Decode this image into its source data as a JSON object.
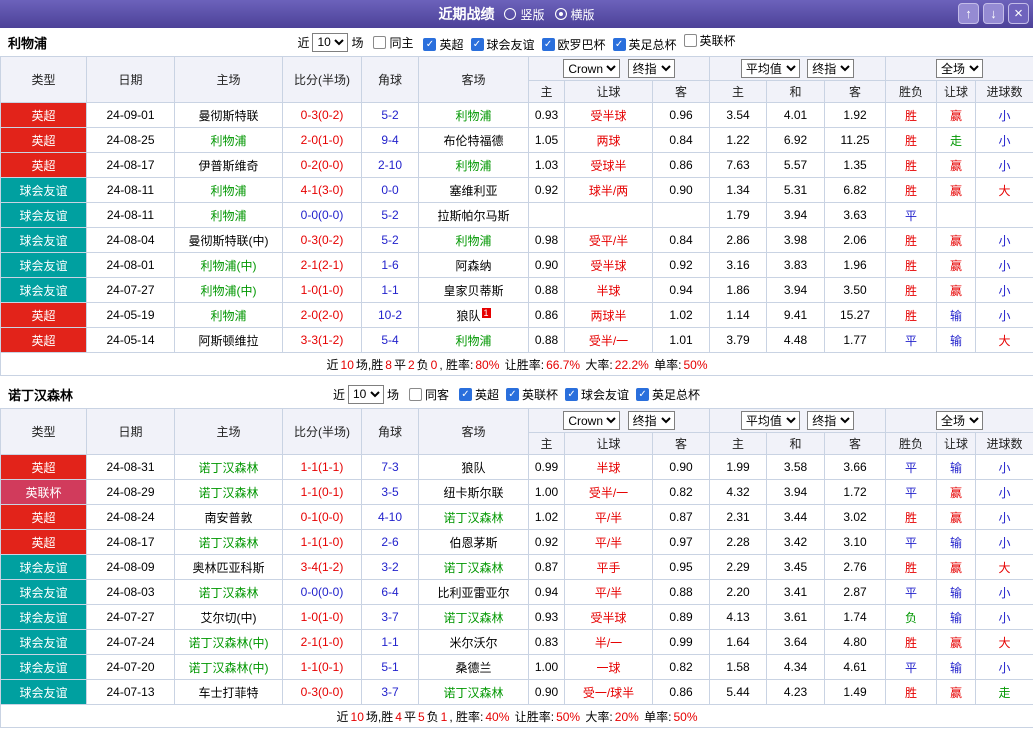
{
  "topbar": {
    "title": "近期战绩",
    "radios": [
      {
        "label": "竖版",
        "checked": false
      },
      {
        "label": "横版",
        "checked": true
      }
    ],
    "buttons": {
      "up": "↑",
      "down": "↓",
      "close": "×"
    }
  },
  "colors": {
    "topbar": "#554aa0",
    "league_epl": "#e2231a",
    "league_cup": "#d13b5c",
    "league_friendly": "#00a0a0",
    "text_red": "#e60000",
    "text_blue": "#2222cc",
    "text_green": "#009700"
  },
  "sections": [
    {
      "team": "利物浦",
      "filter": {
        "near_label": "近",
        "count": "10",
        "games_label": "场",
        "same_label": "同主",
        "same_checked": false,
        "leagues": [
          {
            "label": "英超",
            "checked": true
          },
          {
            "label": "球会友谊",
            "checked": true
          },
          {
            "label": "欧罗巴杯",
            "checked": true
          },
          {
            "label": "英足总杯",
            "checked": true
          },
          {
            "label": "英联杯",
            "checked": false
          }
        ]
      },
      "header": {
        "type": "类型",
        "date": "日期",
        "home": "主场",
        "score": "比分(半场)",
        "corner": "角球",
        "away": "客场",
        "asia_selects": [
          "Crown",
          "终指"
        ],
        "euro_selects": [
          "平均值",
          "终指"
        ],
        "full_select": "全场",
        "sub": [
          "主",
          "让球",
          "客",
          "主",
          "和",
          "客",
          "胜负",
          "让球",
          "进球数"
        ]
      },
      "rows": [
        {
          "type": "英超",
          "tc": "epl",
          "date": "24-09-01",
          "home": "曼彻斯特联",
          "hc": "k",
          "hb": "",
          "score": "0-3(0-2)",
          "sc": "r",
          "corner": "5-2",
          "away": "利物浦",
          "ac": "g",
          "ab": "",
          "ah": "0.93",
          "hand": "受半球",
          "aa": "0.96",
          "eh": "3.54",
          "ed": "4.01",
          "ea": "1.92",
          "wl": "胜",
          "wlc": "r",
          "hr": "赢",
          "hrc": "r",
          "gs": "小",
          "gsc": "b"
        },
        {
          "type": "英超",
          "tc": "epl",
          "date": "24-08-25",
          "home": "利物浦",
          "hc": "g",
          "hb": "",
          "score": "2-0(1-0)",
          "sc": "r",
          "corner": "9-4",
          "away": "布伦特福德",
          "ac": "k",
          "ab": "",
          "ah": "1.05",
          "hand": "两球",
          "aa": "0.84",
          "eh": "1.22",
          "ed": "6.92",
          "ea": "11.25",
          "wl": "胜",
          "wlc": "r",
          "hr": "走",
          "hrc": "g",
          "gs": "小",
          "gsc": "b"
        },
        {
          "type": "英超",
          "tc": "epl",
          "date": "24-08-17",
          "home": "伊普斯维奇",
          "hc": "k",
          "hb": "",
          "score": "0-2(0-0)",
          "sc": "r",
          "corner": "2-10",
          "away": "利物浦",
          "ac": "g",
          "ab": "",
          "ah": "1.03",
          "hand": "受球半",
          "aa": "0.86",
          "eh": "7.63",
          "ed": "5.57",
          "ea": "1.35",
          "wl": "胜",
          "wlc": "r",
          "hr": "赢",
          "hrc": "r",
          "gs": "小",
          "gsc": "b"
        },
        {
          "type": "球会友谊",
          "tc": "fr",
          "date": "24-08-11",
          "home": "利物浦",
          "hc": "g",
          "hb": "",
          "score": "4-1(3-0)",
          "sc": "r",
          "corner": "0-0",
          "away": "塞维利亚",
          "ac": "k",
          "ab": "",
          "ah": "0.92",
          "hand": "球半/两",
          "aa": "0.90",
          "eh": "1.34",
          "ed": "5.31",
          "ea": "6.82",
          "wl": "胜",
          "wlc": "r",
          "hr": "赢",
          "hrc": "r",
          "gs": "大",
          "gsc": "r"
        },
        {
          "type": "球会友谊",
          "tc": "fr",
          "date": "24-08-11",
          "home": "利物浦",
          "hc": "g",
          "hb": "",
          "score": "0-0(0-0)",
          "sc": "b",
          "corner": "5-2",
          "away": "拉斯帕尔马斯",
          "ac": "k",
          "ab": "",
          "ah": "",
          "hand": "",
          "aa": "",
          "eh": "1.79",
          "ed": "3.94",
          "ea": "3.63",
          "wl": "平",
          "wlc": "b",
          "hr": "",
          "hrc": "k",
          "gs": "",
          "gsc": "k"
        },
        {
          "type": "球会友谊",
          "tc": "fr",
          "date": "24-08-04",
          "home": "曼彻斯特联(中)",
          "hc": "k",
          "hb": "",
          "score": "0-3(0-2)",
          "sc": "r",
          "corner": "5-2",
          "away": "利物浦",
          "ac": "g",
          "ab": "",
          "ah": "0.98",
          "hand": "受平/半",
          "aa": "0.84",
          "eh": "2.86",
          "ed": "3.98",
          "ea": "2.06",
          "wl": "胜",
          "wlc": "r",
          "hr": "赢",
          "hrc": "r",
          "gs": "小",
          "gsc": "b"
        },
        {
          "type": "球会友谊",
          "tc": "fr",
          "date": "24-08-01",
          "home": "利物浦(中)",
          "hc": "g",
          "hb": "",
          "score": "2-1(2-1)",
          "sc": "r",
          "corner": "1-6",
          "away": "阿森纳",
          "ac": "k",
          "ab": "",
          "ah": "0.90",
          "hand": "受半球",
          "aa": "0.92",
          "eh": "3.16",
          "ed": "3.83",
          "ea": "1.96",
          "wl": "胜",
          "wlc": "r",
          "hr": "赢",
          "hrc": "r",
          "gs": "小",
          "gsc": "b"
        },
        {
          "type": "球会友谊",
          "tc": "fr",
          "date": "24-07-27",
          "home": "利物浦(中)",
          "hc": "g",
          "hb": "",
          "score": "1-0(1-0)",
          "sc": "r",
          "corner": "1-1",
          "away": "皇家贝蒂斯",
          "ac": "k",
          "ab": "",
          "ah": "0.88",
          "hand": "半球",
          "aa": "0.94",
          "eh": "1.86",
          "ed": "3.94",
          "ea": "3.50",
          "wl": "胜",
          "wlc": "r",
          "hr": "赢",
          "hrc": "r",
          "gs": "小",
          "gsc": "b"
        },
        {
          "type": "英超",
          "tc": "epl",
          "date": "24-05-19",
          "home": "利物浦",
          "hc": "g",
          "hb": "",
          "score": "2-0(2-0)",
          "sc": "r",
          "corner": "10-2",
          "away": "狼队",
          "ac": "k",
          "ab": "1",
          "ah": "0.86",
          "hand": "两球半",
          "aa": "1.02",
          "eh": "1.14",
          "ed": "9.41",
          "ea": "15.27",
          "wl": "胜",
          "wlc": "r",
          "hr": "输",
          "hrc": "b",
          "gs": "小",
          "gsc": "b"
        },
        {
          "type": "英超",
          "tc": "epl",
          "date": "24-05-14",
          "home": "阿斯顿维拉",
          "hc": "k",
          "hb": "",
          "score": "3-3(1-2)",
          "sc": "r",
          "corner": "5-4",
          "away": "利物浦",
          "ac": "g",
          "ab": "",
          "ah": "0.88",
          "hand": "受半/一",
          "aa": "1.01",
          "eh": "3.79",
          "ed": "4.48",
          "ea": "1.77",
          "wl": "平",
          "wlc": "b",
          "hr": "输",
          "hrc": "b",
          "gs": "大",
          "gsc": "r"
        }
      ],
      "summary": [
        {
          "t": "近",
          "c": "k"
        },
        {
          "t": "10",
          "c": "r"
        },
        {
          "t": "场,胜",
          "c": "k"
        },
        {
          "t": "8",
          "c": "r"
        },
        {
          "t": "平",
          "c": "k"
        },
        {
          "t": "2",
          "c": "r"
        },
        {
          "t": "负",
          "c": "k"
        },
        {
          "t": "0",
          "c": "r"
        },
        {
          "t": ", 胜率:",
          "c": "k"
        },
        {
          "t": "80%",
          "c": "r"
        },
        {
          "t": " 让胜率:",
          "c": "k"
        },
        {
          "t": "66.7%",
          "c": "r"
        },
        {
          "t": " 大率:",
          "c": "k"
        },
        {
          "t": "22.2%",
          "c": "r"
        },
        {
          "t": " 单率:",
          "c": "k"
        },
        {
          "t": "50%",
          "c": "r"
        }
      ]
    },
    {
      "team": "诺丁汉森林",
      "filter": {
        "near_label": "近",
        "count": "10",
        "games_label": "场",
        "same_label": "同客",
        "same_checked": false,
        "leagues": [
          {
            "label": "英超",
            "checked": true
          },
          {
            "label": "英联杯",
            "checked": true
          },
          {
            "label": "球会友谊",
            "checked": true
          },
          {
            "label": "英足总杯",
            "checked": true
          }
        ]
      },
      "header": {
        "type": "类型",
        "date": "日期",
        "home": "主场",
        "score": "比分(半场)",
        "corner": "角球",
        "away": "客场",
        "asia_selects": [
          "Crown",
          "终指"
        ],
        "euro_selects": [
          "平均值",
          "终指"
        ],
        "full_select": "全场",
        "sub": [
          "主",
          "让球",
          "客",
          "主",
          "和",
          "客",
          "胜负",
          "让球",
          "进球数"
        ]
      },
      "rows": [
        {
          "type": "英超",
          "tc": "epl",
          "date": "24-08-31",
          "home": "诺丁汉森林",
          "hc": "g",
          "hb": "",
          "score": "1-1(1-1)",
          "sc": "r",
          "corner": "7-3",
          "away": "狼队",
          "ac": "k",
          "ab": "",
          "ah": "0.99",
          "hand": "半球",
          "aa": "0.90",
          "eh": "1.99",
          "ed": "3.58",
          "ea": "3.66",
          "wl": "平",
          "wlc": "b",
          "hr": "输",
          "hrc": "b",
          "gs": "小",
          "gsc": "b"
        },
        {
          "type": "英联杯",
          "tc": "cup",
          "date": "24-08-29",
          "home": "诺丁汉森林",
          "hc": "g",
          "hb": "",
          "score": "1-1(0-1)",
          "sc": "r",
          "corner": "3-5",
          "away": "纽卡斯尔联",
          "ac": "k",
          "ab": "",
          "ah": "1.00",
          "hand": "受半/一",
          "aa": "0.82",
          "eh": "4.32",
          "ed": "3.94",
          "ea": "1.72",
          "wl": "平",
          "wlc": "b",
          "hr": "赢",
          "hrc": "r",
          "gs": "小",
          "gsc": "b"
        },
        {
          "type": "英超",
          "tc": "epl",
          "date": "24-08-24",
          "home": "南安普敦",
          "hc": "k",
          "hb": "",
          "score": "0-1(0-0)",
          "sc": "r",
          "corner": "4-10",
          "away": "诺丁汉森林",
          "ac": "g",
          "ab": "",
          "ah": "1.02",
          "hand": "平/半",
          "aa": "0.87",
          "eh": "2.31",
          "ed": "3.44",
          "ea": "3.02",
          "wl": "胜",
          "wlc": "r",
          "hr": "赢",
          "hrc": "r",
          "gs": "小",
          "gsc": "b"
        },
        {
          "type": "英超",
          "tc": "epl",
          "date": "24-08-17",
          "home": "诺丁汉森林",
          "hc": "g",
          "hb": "",
          "score": "1-1(1-0)",
          "sc": "r",
          "corner": "2-6",
          "away": "伯恩茅斯",
          "ac": "k",
          "ab": "",
          "ah": "0.92",
          "hand": "平/半",
          "aa": "0.97",
          "eh": "2.28",
          "ed": "3.42",
          "ea": "3.10",
          "wl": "平",
          "wlc": "b",
          "hr": "输",
          "hrc": "b",
          "gs": "小",
          "gsc": "b"
        },
        {
          "type": "球会友谊",
          "tc": "fr",
          "date": "24-08-09",
          "home": "奥林匹亚科斯",
          "hc": "k",
          "hb": "",
          "score": "3-4(1-2)",
          "sc": "r",
          "corner": "3-2",
          "away": "诺丁汉森林",
          "ac": "g",
          "ab": "",
          "ah": "0.87",
          "hand": "平手",
          "aa": "0.95",
          "eh": "2.29",
          "ed": "3.45",
          "ea": "2.76",
          "wl": "胜",
          "wlc": "r",
          "hr": "赢",
          "hrc": "r",
          "gs": "大",
          "gsc": "r"
        },
        {
          "type": "球会友谊",
          "tc": "fr",
          "date": "24-08-03",
          "home": "诺丁汉森林",
          "hc": "g",
          "hb": "",
          "score": "0-0(0-0)",
          "sc": "b",
          "corner": "6-4",
          "away": "比利亚雷亚尔",
          "ac": "k",
          "ab": "",
          "ah": "0.94",
          "hand": "平/半",
          "aa": "0.88",
          "eh": "2.20",
          "ed": "3.41",
          "ea": "2.87",
          "wl": "平",
          "wlc": "b",
          "hr": "输",
          "hrc": "b",
          "gs": "小",
          "gsc": "b"
        },
        {
          "type": "球会友谊",
          "tc": "fr",
          "date": "24-07-27",
          "home": "艾尔切(中)",
          "hc": "k",
          "hb": "",
          "score": "1-0(1-0)",
          "sc": "r",
          "corner": "3-7",
          "away": "诺丁汉森林",
          "ac": "g",
          "ab": "",
          "ah": "0.93",
          "hand": "受半球",
          "aa": "0.89",
          "eh": "4.13",
          "ed": "3.61",
          "ea": "1.74",
          "wl": "负",
          "wlc": "g",
          "hr": "输",
          "hrc": "b",
          "gs": "小",
          "gsc": "b"
        },
        {
          "type": "球会友谊",
          "tc": "fr",
          "date": "24-07-24",
          "home": "诺丁汉森林(中)",
          "hc": "g",
          "hb": "",
          "score": "2-1(1-0)",
          "sc": "r",
          "corner": "1-1",
          "away": "米尔沃尔",
          "ac": "k",
          "ab": "",
          "ah": "0.83",
          "hand": "半/一",
          "aa": "0.99",
          "eh": "1.64",
          "ed": "3.64",
          "ea": "4.80",
          "wl": "胜",
          "wlc": "r",
          "hr": "赢",
          "hrc": "r",
          "gs": "大",
          "gsc": "r"
        },
        {
          "type": "球会友谊",
          "tc": "fr",
          "date": "24-07-20",
          "home": "诺丁汉森林(中)",
          "hc": "g",
          "hb": "",
          "score": "1-1(0-1)",
          "sc": "r",
          "corner": "5-1",
          "away": "桑德兰",
          "ac": "k",
          "ab": "",
          "ah": "1.00",
          "hand": "一球",
          "aa": "0.82",
          "eh": "1.58",
          "ed": "4.34",
          "ea": "4.61",
          "wl": "平",
          "wlc": "b",
          "hr": "输",
          "hrc": "b",
          "gs": "小",
          "gsc": "b"
        },
        {
          "type": "球会友谊",
          "tc": "fr",
          "date": "24-07-13",
          "home": "车士打菲特",
          "hc": "k",
          "hb": "",
          "score": "0-3(0-0)",
          "sc": "r",
          "corner": "3-7",
          "away": "诺丁汉森林",
          "ac": "g",
          "ab": "",
          "ah": "0.90",
          "hand": "受一/球半",
          "aa": "0.86",
          "eh": "5.44",
          "ed": "4.23",
          "ea": "1.49",
          "wl": "胜",
          "wlc": "r",
          "hr": "赢",
          "hrc": "r",
          "gs": "走",
          "gsc": "g"
        }
      ],
      "summary": [
        {
          "t": "近",
          "c": "k"
        },
        {
          "t": "10",
          "c": "r"
        },
        {
          "t": "场,胜",
          "c": "k"
        },
        {
          "t": "4",
          "c": "r"
        },
        {
          "t": "平",
          "c": "k"
        },
        {
          "t": "5",
          "c": "r"
        },
        {
          "t": "负",
          "c": "k"
        },
        {
          "t": "1",
          "c": "r"
        },
        {
          "t": ", 胜率:",
          "c": "k"
        },
        {
          "t": "40%",
          "c": "r"
        },
        {
          "t": " 让胜率:",
          "c": "k"
        },
        {
          "t": "50%",
          "c": "r"
        },
        {
          "t": " 大率:",
          "c": "k"
        },
        {
          "t": "20%",
          "c": "r"
        },
        {
          "t": " 单率:",
          "c": "k"
        },
        {
          "t": "50%",
          "c": "r"
        }
      ]
    }
  ]
}
